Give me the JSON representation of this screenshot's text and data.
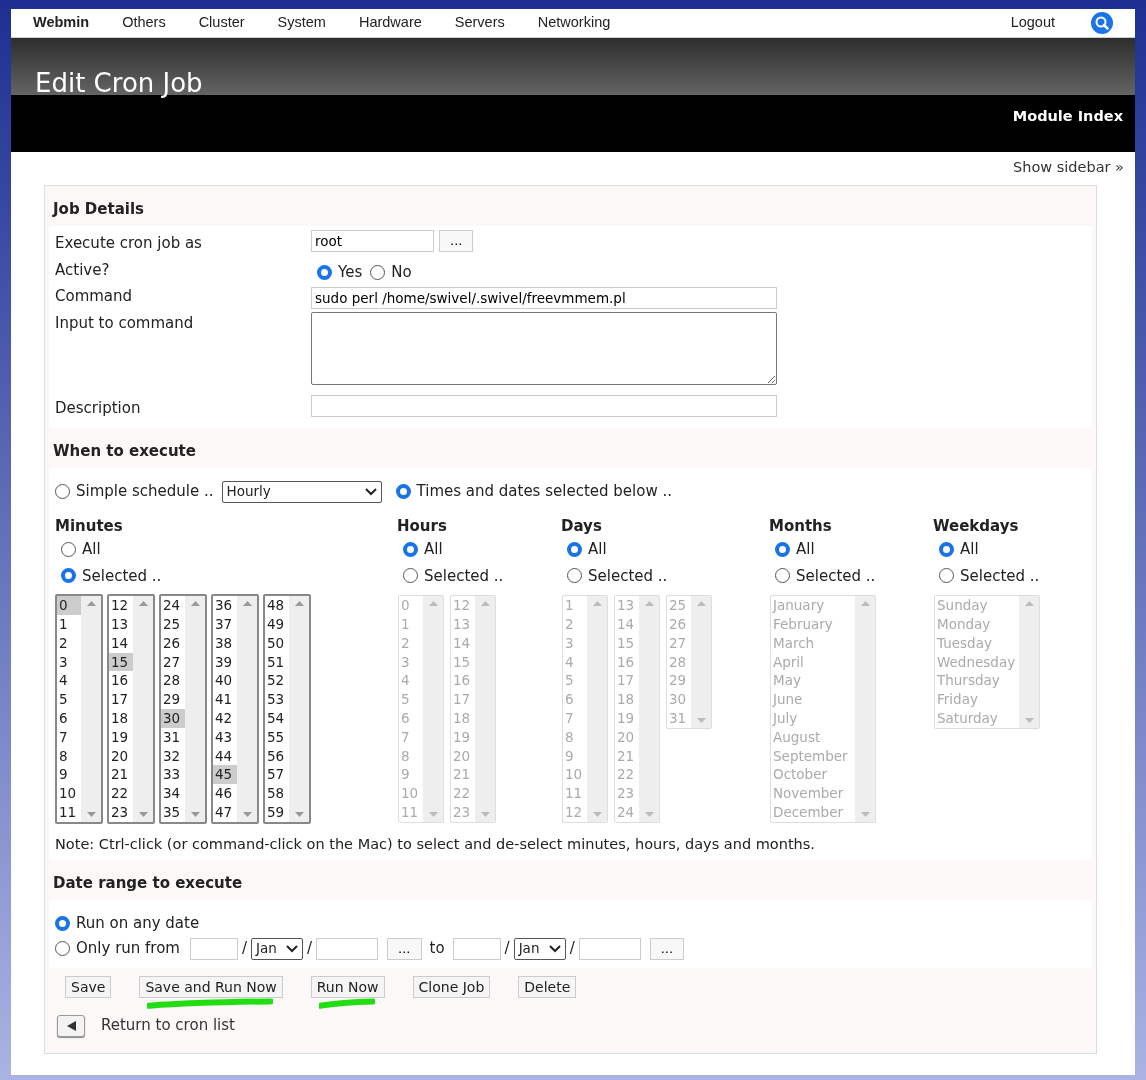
{
  "nav": {
    "brand": "Webmin",
    "items": [
      "Others",
      "Cluster",
      "System",
      "Hardware",
      "Servers",
      "Networking"
    ],
    "logout": "Logout"
  },
  "header": {
    "title": "Edit Cron Job",
    "module_index": "Module Index"
  },
  "show_sidebar": "Show sidebar »",
  "job_details": {
    "title": "Job Details",
    "user": {
      "label": "Execute cron job as",
      "value": "root",
      "picker": "..."
    },
    "active": {
      "label": "Active?",
      "options": [
        {
          "label": "Yes",
          "selected": true
        },
        {
          "label": "No",
          "selected": false
        }
      ]
    },
    "command": {
      "label": "Command",
      "value": "sudo perl /home/swivel/.swivel/freevmmem.pl"
    },
    "input": {
      "label": "Input to command"
    },
    "description": {
      "label": "Description"
    }
  },
  "when": {
    "title": "When to execute",
    "simple": {
      "label": "Simple schedule ..",
      "selected": false,
      "dropdown": "Hourly"
    },
    "times": {
      "label": "Times and dates selected below ..",
      "selected": true
    },
    "groups": [
      {
        "title": "Minutes",
        "disabled": false,
        "options": [
          {
            "label": "All",
            "selected": false
          },
          {
            "label": "Selected ..",
            "selected": true
          }
        ],
        "lists": [
          {
            "items": [
              {
                "label": "0",
                "selected": true
              },
              {
                "label": "1",
                "selected": false
              },
              {
                "label": "2",
                "selected": false
              },
              {
                "label": "3",
                "selected": false
              },
              {
                "label": "4",
                "selected": false
              },
              {
                "label": "5",
                "selected": false
              },
              {
                "label": "6",
                "selected": false
              },
              {
                "label": "7",
                "selected": false
              },
              {
                "label": "8",
                "selected": false
              },
              {
                "label": "9",
                "selected": false
              },
              {
                "label": "10",
                "selected": false
              },
              {
                "label": "11",
                "selected": false
              }
            ]
          },
          {
            "items": [
              {
                "label": "12",
                "selected": false
              },
              {
                "label": "13",
                "selected": false
              },
              {
                "label": "14",
                "selected": false
              },
              {
                "label": "15",
                "selected": true
              },
              {
                "label": "16",
                "selected": false
              },
              {
                "label": "17",
                "selected": false
              },
              {
                "label": "18",
                "selected": false
              },
              {
                "label": "19",
                "selected": false
              },
              {
                "label": "20",
                "selected": false
              },
              {
                "label": "21",
                "selected": false
              },
              {
                "label": "22",
                "selected": false
              },
              {
                "label": "23",
                "selected": false
              }
            ]
          },
          {
            "items": [
              {
                "label": "24",
                "selected": false
              },
              {
                "label": "25",
                "selected": false
              },
              {
                "label": "26",
                "selected": false
              },
              {
                "label": "27",
                "selected": false
              },
              {
                "label": "28",
                "selected": false
              },
              {
                "label": "29",
                "selected": false
              },
              {
                "label": "30",
                "selected": true
              },
              {
                "label": "31",
                "selected": false
              },
              {
                "label": "32",
                "selected": false
              },
              {
                "label": "33",
                "selected": false
              },
              {
                "label": "34",
                "selected": false
              },
              {
                "label": "35",
                "selected": false
              }
            ]
          },
          {
            "items": [
              {
                "label": "36",
                "selected": false
              },
              {
                "label": "37",
                "selected": false
              },
              {
                "label": "38",
                "selected": false
              },
              {
                "label": "39",
                "selected": false
              },
              {
                "label": "40",
                "selected": false
              },
              {
                "label": "41",
                "selected": false
              },
              {
                "label": "42",
                "selected": false
              },
              {
                "label": "43",
                "selected": false
              },
              {
                "label": "44",
                "selected": false
              },
              {
                "label": "45",
                "selected": true
              },
              {
                "label": "46",
                "selected": false
              },
              {
                "label": "47",
                "selected": false
              }
            ]
          },
          {
            "items": [
              {
                "label": "48",
                "selected": false
              },
              {
                "label": "49",
                "selected": false
              },
              {
                "label": "50",
                "selected": false
              },
              {
                "label": "51",
                "selected": false
              },
              {
                "label": "52",
                "selected": false
              },
              {
                "label": "53",
                "selected": false
              },
              {
                "label": "54",
                "selected": false
              },
              {
                "label": "55",
                "selected": false
              },
              {
                "label": "56",
                "selected": false
              },
              {
                "label": "57",
                "selected": false
              },
              {
                "label": "58",
                "selected": false
              },
              {
                "label": "59",
                "selected": false
              }
            ]
          }
        ]
      },
      {
        "title": "Hours",
        "disabled": true,
        "options": [
          {
            "label": "All",
            "selected": true
          },
          {
            "label": "Selected ..",
            "selected": false
          }
        ],
        "lists": [
          {
            "items": [
              {
                "label": "0",
                "selected": false
              },
              {
                "label": "1",
                "selected": false
              },
              {
                "label": "2",
                "selected": false
              },
              {
                "label": "3",
                "selected": false
              },
              {
                "label": "4",
                "selected": false
              },
              {
                "label": "5",
                "selected": false
              },
              {
                "label": "6",
                "selected": false
              },
              {
                "label": "7",
                "selected": false
              },
              {
                "label": "8",
                "selected": false
              },
              {
                "label": "9",
                "selected": false
              },
              {
                "label": "10",
                "selected": false
              },
              {
                "label": "11",
                "selected": false
              }
            ]
          },
          {
            "items": [
              {
                "label": "12",
                "selected": false
              },
              {
                "label": "13",
                "selected": false
              },
              {
                "label": "14",
                "selected": false
              },
              {
                "label": "15",
                "selected": false
              },
              {
                "label": "16",
                "selected": false
              },
              {
                "label": "17",
                "selected": false
              },
              {
                "label": "18",
                "selected": false
              },
              {
                "label": "19",
                "selected": false
              },
              {
                "label": "20",
                "selected": false
              },
              {
                "label": "21",
                "selected": false
              },
              {
                "label": "22",
                "selected": false
              },
              {
                "label": "23",
                "selected": false
              }
            ]
          }
        ]
      },
      {
        "title": "Days",
        "disabled": true,
        "options": [
          {
            "label": "All",
            "selected": true
          },
          {
            "label": "Selected ..",
            "selected": false
          }
        ],
        "lists": [
          {
            "items": [
              {
                "label": "1",
                "selected": false
              },
              {
                "label": "2",
                "selected": false
              },
              {
                "label": "3",
                "selected": false
              },
              {
                "label": "4",
                "selected": false
              },
              {
                "label": "5",
                "selected": false
              },
              {
                "label": "6",
                "selected": false
              },
              {
                "label": "7",
                "selected": false
              },
              {
                "label": "8",
                "selected": false
              },
              {
                "label": "9",
                "selected": false
              },
              {
                "label": "10",
                "selected": false
              },
              {
                "label": "11",
                "selected": false
              },
              {
                "label": "12",
                "selected": false
              }
            ]
          },
          {
            "items": [
              {
                "label": "13",
                "selected": false
              },
              {
                "label": "14",
                "selected": false
              },
              {
                "label": "15",
                "selected": false
              },
              {
                "label": "16",
                "selected": false
              },
              {
                "label": "17",
                "selected": false
              },
              {
                "label": "18",
                "selected": false
              },
              {
                "label": "19",
                "selected": false
              },
              {
                "label": "20",
                "selected": false
              },
              {
                "label": "21",
                "selected": false
              },
              {
                "label": "22",
                "selected": false
              },
              {
                "label": "23",
                "selected": false
              },
              {
                "label": "24",
                "selected": false
              }
            ]
          },
          {
            "items": [
              {
                "label": "25",
                "selected": false
              },
              {
                "label": "26",
                "selected": false
              },
              {
                "label": "27",
                "selected": false
              },
              {
                "label": "28",
                "selected": false
              },
              {
                "label": "29",
                "selected": false
              },
              {
                "label": "30",
                "selected": false
              },
              {
                "label": "31",
                "selected": false
              }
            ]
          }
        ]
      },
      {
        "title": "Months",
        "disabled": true,
        "options": [
          {
            "label": "All",
            "selected": true
          },
          {
            "label": "Selected ..",
            "selected": false
          }
        ],
        "lists": [
          {
            "items": [
              {
                "label": "January",
                "selected": false
              },
              {
                "label": "February",
                "selected": false
              },
              {
                "label": "March",
                "selected": false
              },
              {
                "label": "April",
                "selected": false
              },
              {
                "label": "May",
                "selected": false
              },
              {
                "label": "June",
                "selected": false
              },
              {
                "label": "July",
                "selected": false
              },
              {
                "label": "August",
                "selected": false
              },
              {
                "label": "September",
                "selected": false
              },
              {
                "label": "October",
                "selected": false
              },
              {
                "label": "November",
                "selected": false
              },
              {
                "label": "December",
                "selected": false
              }
            ]
          }
        ]
      },
      {
        "title": "Weekdays",
        "disabled": true,
        "options": [
          {
            "label": "All",
            "selected": true
          },
          {
            "label": "Selected ..",
            "selected": false
          }
        ],
        "lists": [
          {
            "items": [
              {
                "label": "Sunday",
                "selected": false
              },
              {
                "label": "Monday",
                "selected": false
              },
              {
                "label": "Tuesday",
                "selected": false
              },
              {
                "label": "Wednesday",
                "selected": false
              },
              {
                "label": "Thursday",
                "selected": false
              },
              {
                "label": "Friday",
                "selected": false
              },
              {
                "label": "Saturday",
                "selected": false
              }
            ]
          }
        ]
      }
    ],
    "note": "Note: Ctrl-click (or command-click on the Mac) to select and de-select minutes, hours, days and months."
  },
  "date_range": {
    "title": "Date range to execute",
    "any": {
      "label": "Run on any date",
      "selected": true
    },
    "only": {
      "label": "Only run from",
      "selected": false,
      "from_month": "Jan",
      "sep": "/",
      "picker": "...",
      "to": "to",
      "to_month": "Jan"
    }
  },
  "buttons": [
    {
      "label": "Save",
      "marked": false
    },
    {
      "label": "Save and Run Now",
      "marked": true
    },
    {
      "label": "Run Now",
      "marked": true
    },
    {
      "label": "Clone Job",
      "marked": false
    },
    {
      "label": "Delete",
      "marked": false
    }
  ],
  "return_link": "Return to cron list"
}
